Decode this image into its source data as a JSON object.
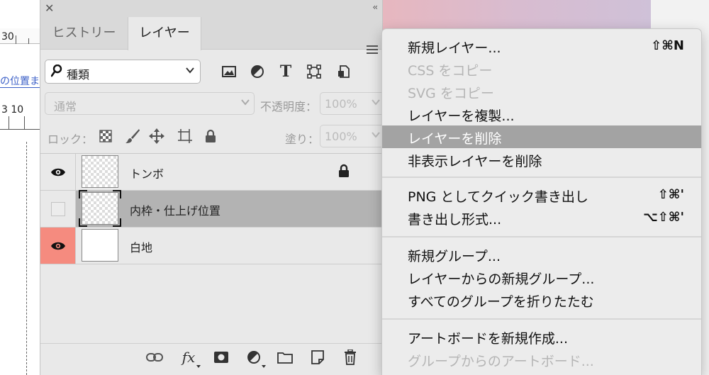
{
  "document": {
    "ruler_top_number": "30",
    "guide_text": "の位置ま",
    "ruler_mid_numbers": "3 10"
  },
  "panel": {
    "close_icon": "✕",
    "collapse_icon": "‹‹",
    "tabs": [
      {
        "label": "ヒストリー",
        "active": false
      },
      {
        "label": "レイヤー",
        "active": true
      }
    ],
    "filter": {
      "label": "種類",
      "search_icon": "search-icon"
    },
    "blend_mode": "通常",
    "opacity_label": "不透明度：",
    "opacity_value": "100%",
    "lock_label": "ロック：",
    "fill_label": "塗り：",
    "fill_value": "100%",
    "type_icon_glyph": "T",
    "fx_glyph": "fx",
    "layers": [
      {
        "name": "トンボ",
        "visible": true,
        "locked": true,
        "selected": false,
        "thumb": "transparent"
      },
      {
        "name": "内枠・仕上げ位置",
        "visible": false,
        "locked": false,
        "selected": true,
        "thumb": "transparent"
      },
      {
        "name": "白地",
        "visible": true,
        "locked": false,
        "selected": false,
        "thumb": "white",
        "eye_color": "#f58b7f"
      }
    ]
  },
  "menu": {
    "group1": [
      {
        "label": "新規レイヤー...",
        "shortcut": "⇧⌘N",
        "disabled": false
      },
      {
        "label": "CSS をコピー",
        "shortcut": "",
        "disabled": true
      },
      {
        "label": "SVG をコピー",
        "shortcut": "",
        "disabled": true
      },
      {
        "label": "レイヤーを複製...",
        "shortcut": "",
        "disabled": false
      },
      {
        "label": "レイヤーを削除",
        "shortcut": "",
        "disabled": false,
        "highlighted": true
      },
      {
        "label": "非表示レイヤーを削除",
        "shortcut": "",
        "disabled": false
      }
    ],
    "group2": [
      {
        "label": "PNG としてクイック書き出し",
        "shortcut": "⇧⌘'",
        "disabled": false
      },
      {
        "label": "書き出し形式...",
        "shortcut": "⌥⇧⌘'",
        "disabled": false
      }
    ],
    "group3": [
      {
        "label": "新規グループ...",
        "shortcut": "",
        "disabled": false
      },
      {
        "label": "レイヤーからの新規グループ...",
        "shortcut": "",
        "disabled": false
      },
      {
        "label": "すべてのグループを折りたたむ",
        "shortcut": "",
        "disabled": false
      }
    ],
    "group4": [
      {
        "label": "アートボードを新規作成...",
        "shortcut": "",
        "disabled": false
      },
      {
        "label": "グループからのアートボード...",
        "shortcut": "",
        "disabled": true
      }
    ]
  },
  "colors": {
    "highlight": "#a3a3a3",
    "eye_red": "#f58b7f",
    "guide_blue": "#3b5fc7"
  }
}
